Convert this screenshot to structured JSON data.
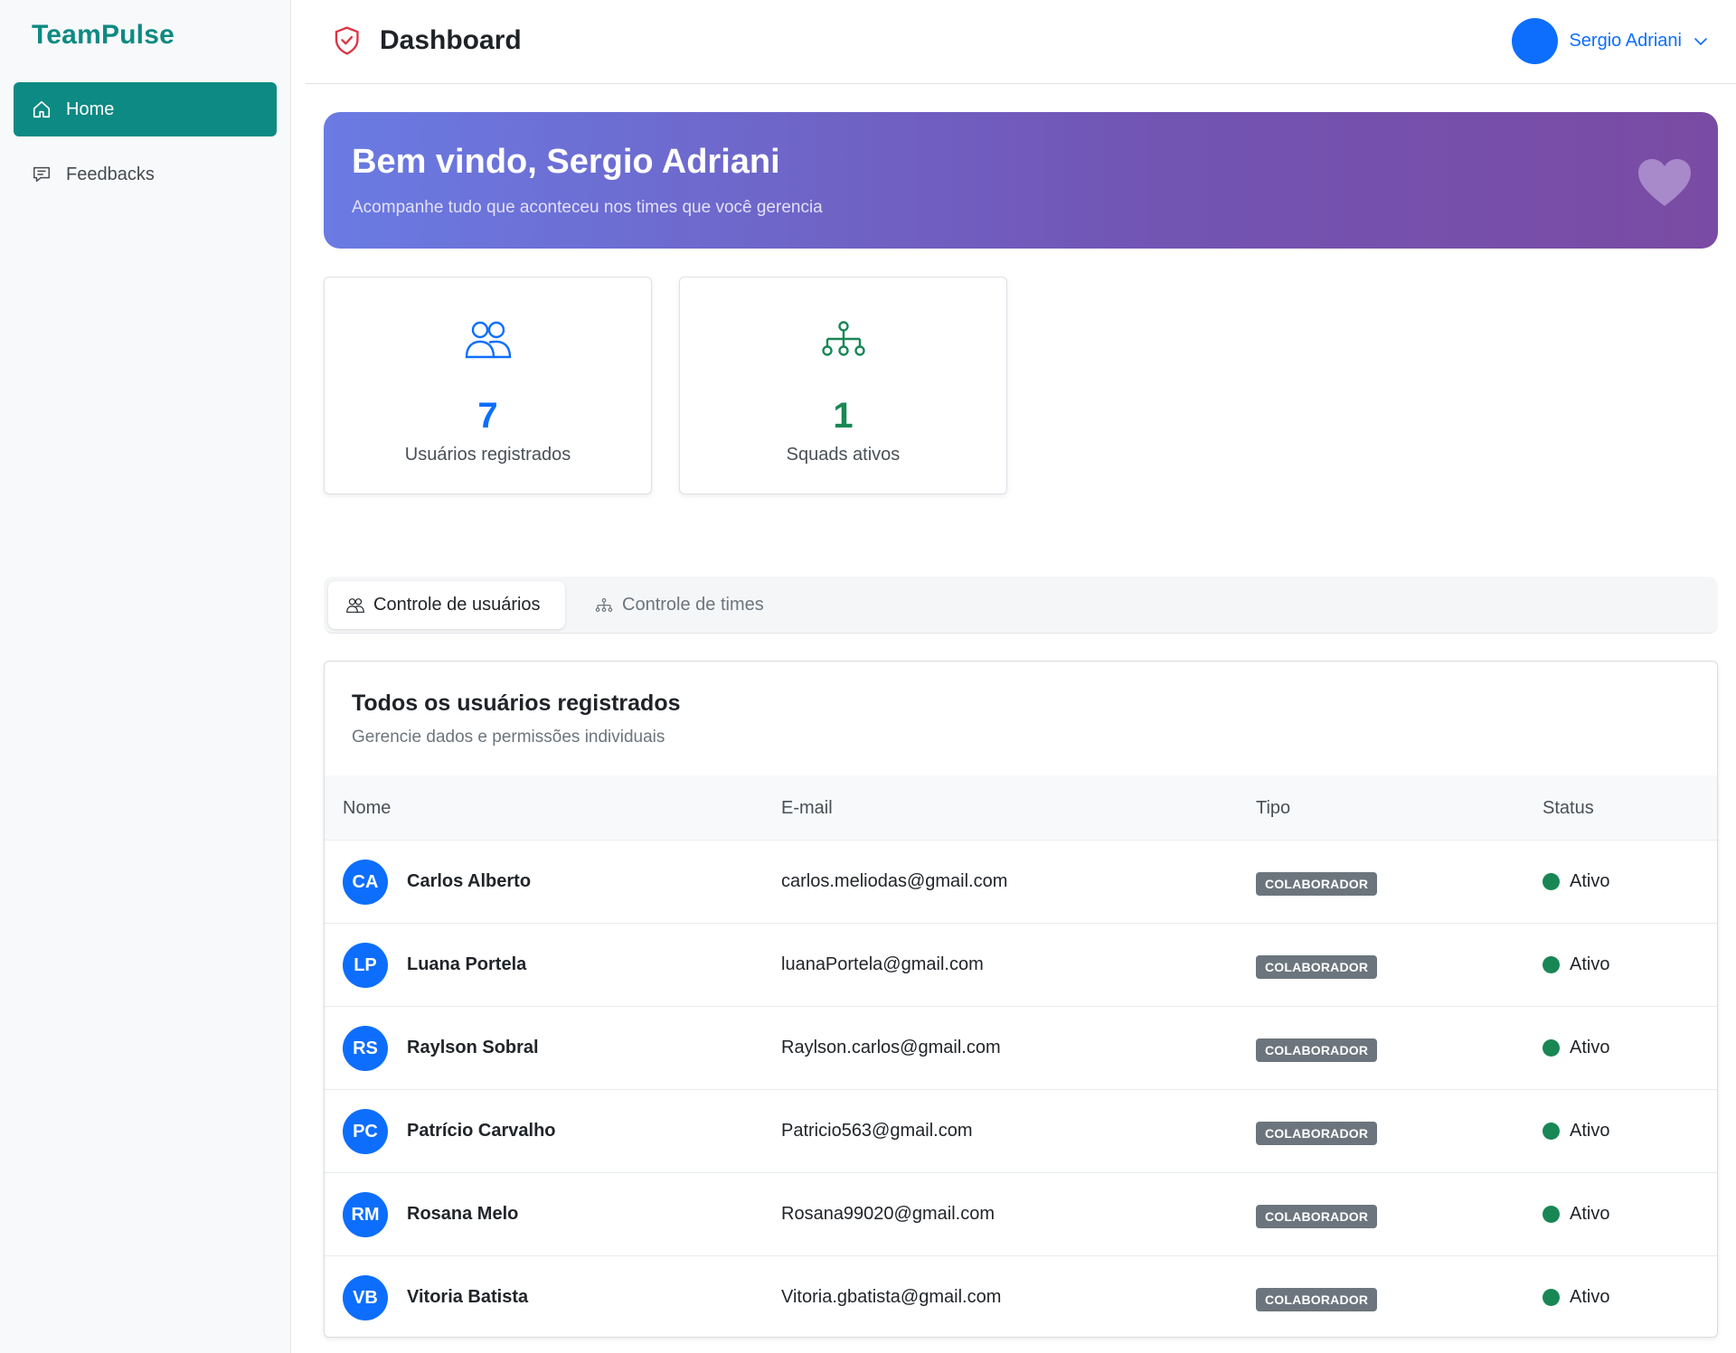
{
  "sidebar": {
    "brand": "TeamPulse",
    "items": [
      {
        "label": "Home",
        "icon": "home-icon",
        "active": true
      },
      {
        "label": "Feedbacks",
        "icon": "chat-icon",
        "active": false
      }
    ]
  },
  "header": {
    "title": "Dashboard",
    "user_name": "Sergio Adriani"
  },
  "banner": {
    "title": "Bem vindo, Sergio Adriani",
    "subtitle": "Acompanhe tudo que aconteceu nos times que você gerencia"
  },
  "stats": [
    {
      "value": "7",
      "label": "Usuários registrados",
      "icon": "users-icon",
      "color": "#0d6efd"
    },
    {
      "value": "1",
      "label": "Squads ativos",
      "icon": "hierarchy-icon",
      "color": "#198754"
    }
  ],
  "tabs": [
    {
      "label": "Controle de usuários",
      "active": true
    },
    {
      "label": "Controle de times",
      "active": false
    }
  ],
  "users_table": {
    "title": "Todos os usuários registrados",
    "subtitle": "Gerencie dados e permissões individuais",
    "columns": [
      "Nome",
      "E-mail",
      "Tipo",
      "Status"
    ],
    "rows": [
      {
        "initials": "CA",
        "name": "Carlos Alberto",
        "email": "carlos.meliodas@gmail.com",
        "type": "COLABORADOR",
        "status": "Ativo"
      },
      {
        "initials": "LP",
        "name": "Luana Portela",
        "email": "luanaPortela@gmail.com",
        "type": "COLABORADOR",
        "status": "Ativo"
      },
      {
        "initials": "RS",
        "name": "Raylson Sobral",
        "email": "Raylson.carlos@gmail.com",
        "type": "COLABORADOR",
        "status": "Ativo"
      },
      {
        "initials": "PC",
        "name": "Patrício Carvalho",
        "email": "Patricio563@gmail.com",
        "type": "COLABORADOR",
        "status": "Ativo"
      },
      {
        "initials": "RM",
        "name": "Rosana Melo",
        "email": "Rosana99020@gmail.com",
        "type": "COLABORADOR",
        "status": "Ativo"
      },
      {
        "initials": "VB",
        "name": "Vitoria Batista",
        "email": "Vitoria.gbatista@gmail.com",
        "type": "COLABORADOR",
        "status": "Ativo"
      }
    ]
  },
  "colors": {
    "brand": "#0d8a83",
    "primary": "#0d6efd",
    "success": "#198754",
    "badge": "#6c757d"
  }
}
